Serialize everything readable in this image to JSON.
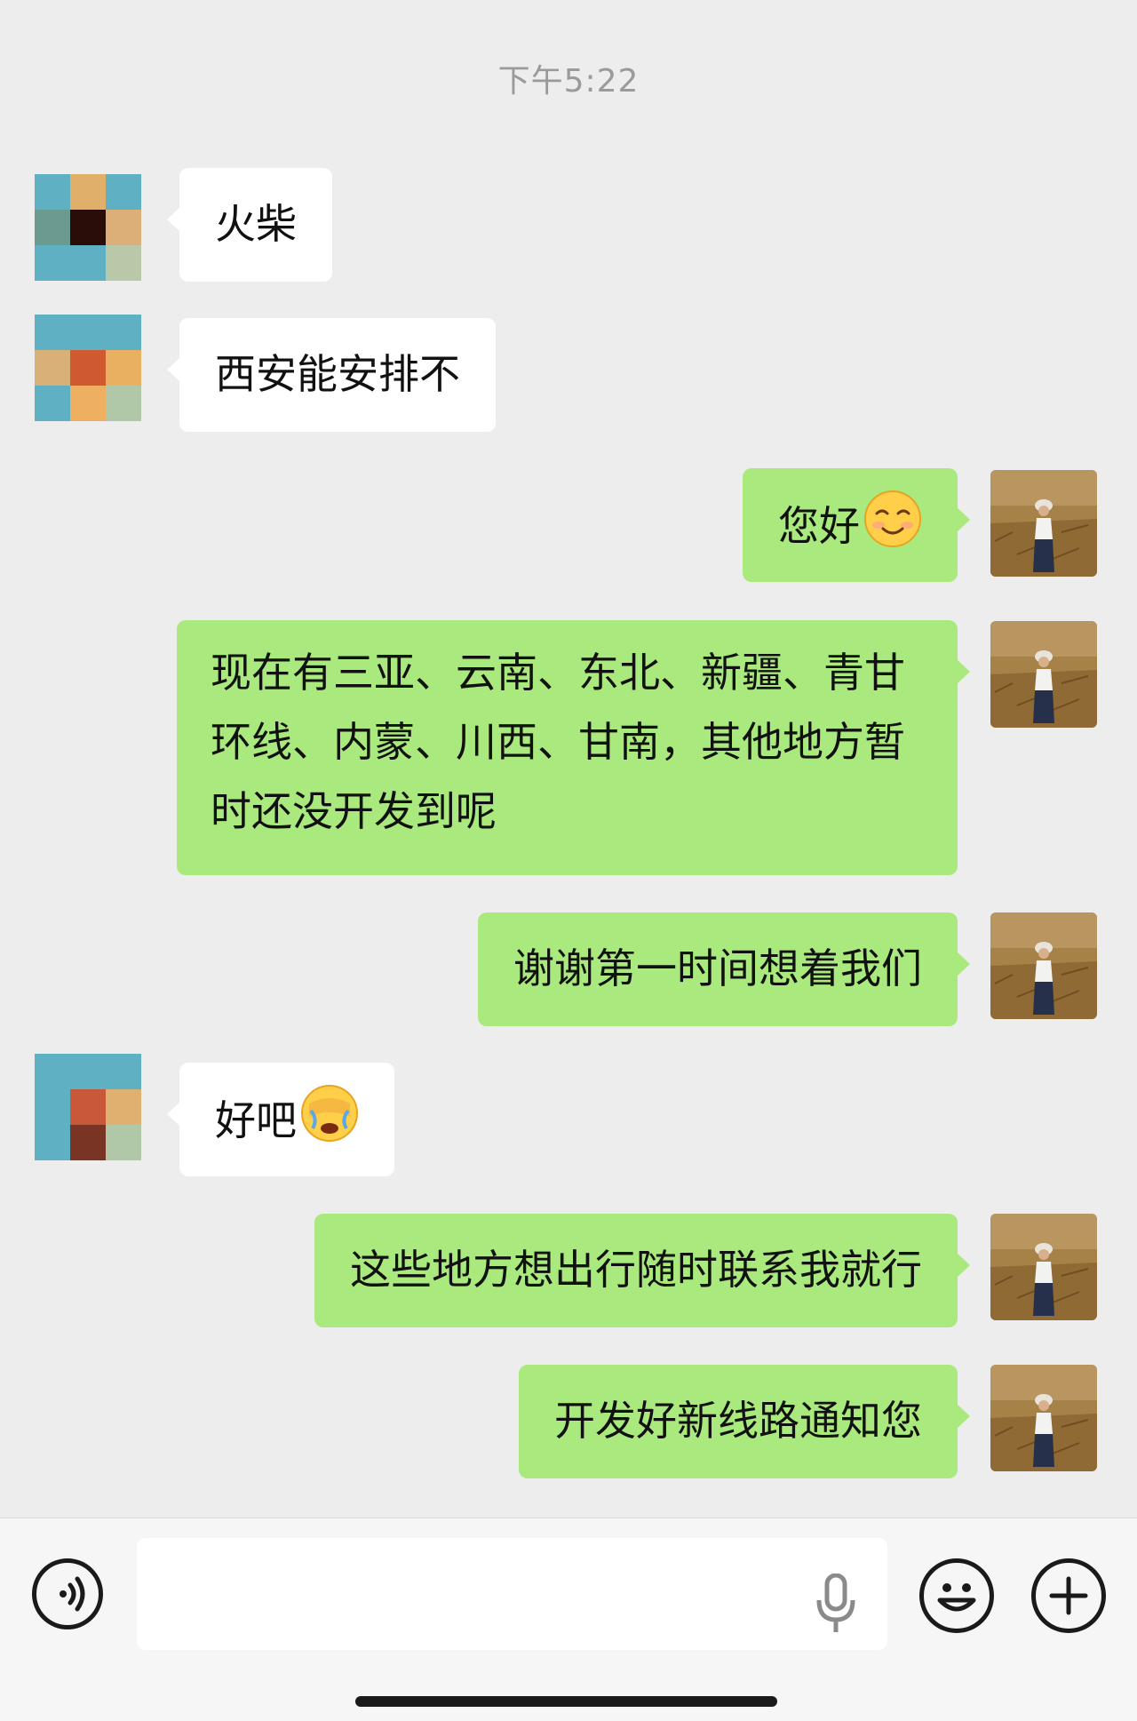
{
  "timestamp": "下午5:22",
  "messages": [
    {
      "text": "火柴",
      "emoji": ""
    },
    {
      "text": "西安能安排不",
      "emoji": ""
    },
    {
      "text": "您好",
      "emoji": "smiling-face-icon"
    },
    {
      "text": "现在有三亚、云南、东北、新疆、青甘环线、内蒙、川西、甘南，其他地方暂时还没开发到呢",
      "emoji": ""
    },
    {
      "text": "谢谢第一时间想着我们",
      "emoji": ""
    },
    {
      "text": "好吧",
      "emoji": "face-palm-icon"
    },
    {
      "text": "这些地方想出行随时联系我就行",
      "emoji": ""
    },
    {
      "text": "开发好新线路通知您",
      "emoji": ""
    }
  ],
  "input": {
    "value": ""
  },
  "icons": [
    "voice-toggle-icon",
    "microphone-icon",
    "emoji-icon",
    "plus-icon"
  ],
  "colors": {
    "background": "#ededed",
    "incoming_bubble": "#ffffff",
    "outgoing_bubble": "#a9e97d",
    "timestamp_text": "#9a9a9a"
  }
}
